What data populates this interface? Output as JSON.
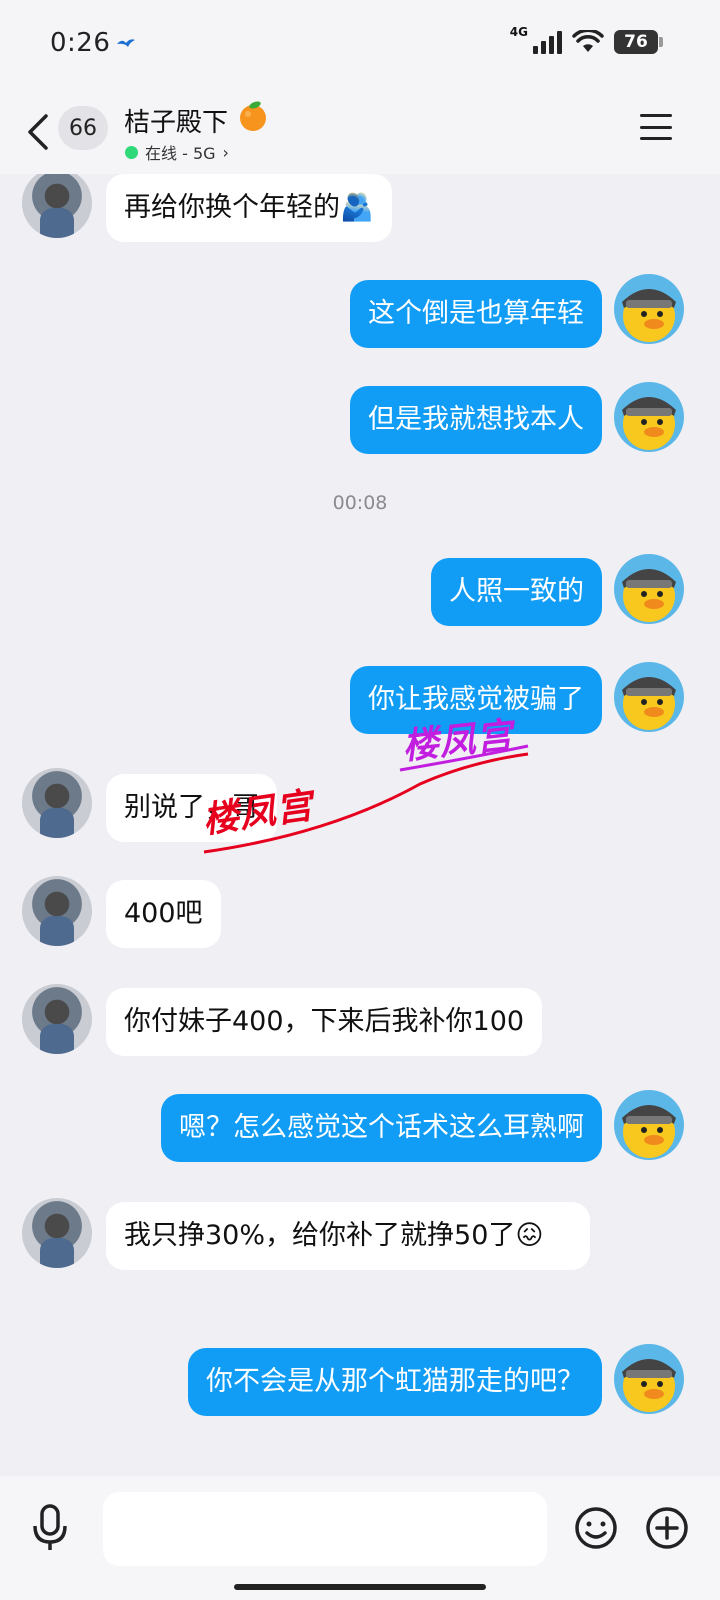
{
  "status_bar": {
    "time": "0:26",
    "network": "4G",
    "battery": "76"
  },
  "header": {
    "unread_count": "66",
    "contact_name": "桔子殿下",
    "status_text": "在线 - 5G",
    "status_chevron": "›"
  },
  "messages": [
    {
      "side": "left",
      "text": "再给你换个年轻的🫂"
    },
    {
      "side": "right",
      "text": "这个倒是也算年轻"
    },
    {
      "side": "right",
      "text": "但是我就想找本人"
    },
    {
      "side": "right",
      "text": "人照一致的"
    },
    {
      "side": "right",
      "text": "你让我感觉被骗了"
    },
    {
      "side": "left",
      "text": "别说了，哥"
    },
    {
      "side": "left",
      "text": "400吧"
    },
    {
      "side": "left",
      "text": "你付妹子400，下来后我补你100"
    },
    {
      "side": "right",
      "text": "嗯？怎么感觉这个话术这么耳熟啊"
    },
    {
      "side": "left",
      "text": "我只挣30%，给你补了就挣50了😖"
    },
    {
      "side": "right",
      "text": "你不会是从那个虹猫那走的吧？"
    }
  ],
  "timestamp": "00:08",
  "watermark": {
    "text": "楼凤宫"
  },
  "colors": {
    "right_bubble": "#119cf5",
    "left_bubble": "#ffffff",
    "background": "#efeff4",
    "online_dot": "#2fd97a",
    "watermark_red": "#e6001e",
    "watermark_purple": "#c21ee0"
  },
  "icons": {
    "back": "chevron-left-icon",
    "menu": "hamburger-menu-icon",
    "mic": "microphone-icon",
    "emoji": "smiley-icon",
    "plus": "plus-circle-icon"
  }
}
